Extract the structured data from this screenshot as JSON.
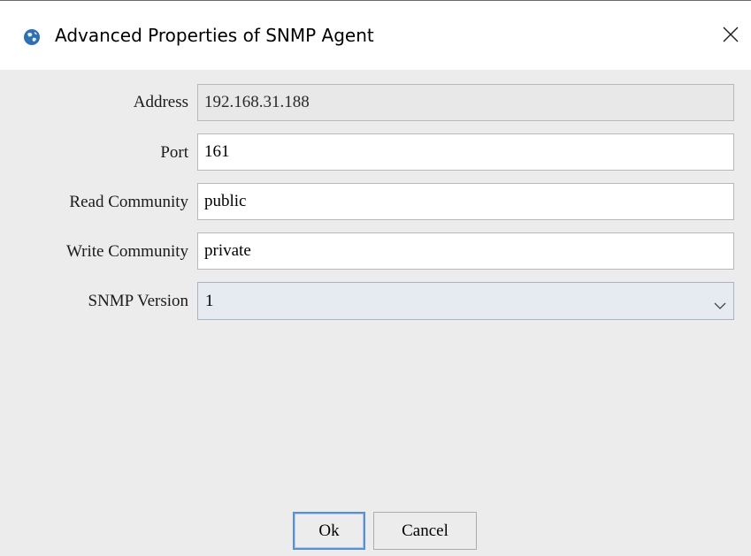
{
  "window": {
    "title": "Advanced Properties of SNMP Agent",
    "app_icon": "globe-icon",
    "close_icon": "close-icon"
  },
  "form": {
    "address": {
      "label": "Address",
      "value": "192.168.31.188",
      "enabled": false
    },
    "port": {
      "label": "Port",
      "value": "161"
    },
    "read_community": {
      "label": "Read Community",
      "value": "public"
    },
    "write_community": {
      "label": "Write Community",
      "value": "private"
    },
    "snmp_version": {
      "label": "SNMP Version",
      "selected": "1",
      "icon": "chevron-down-icon"
    }
  },
  "buttons": {
    "ok_label": "Ok",
    "cancel_label": "Cancel"
  },
  "colors": {
    "dialog_background": "#ececec",
    "titlebar_background": "#ffffff",
    "focus_border": "#5b8fd0",
    "select_background": "#e6ebf2"
  }
}
